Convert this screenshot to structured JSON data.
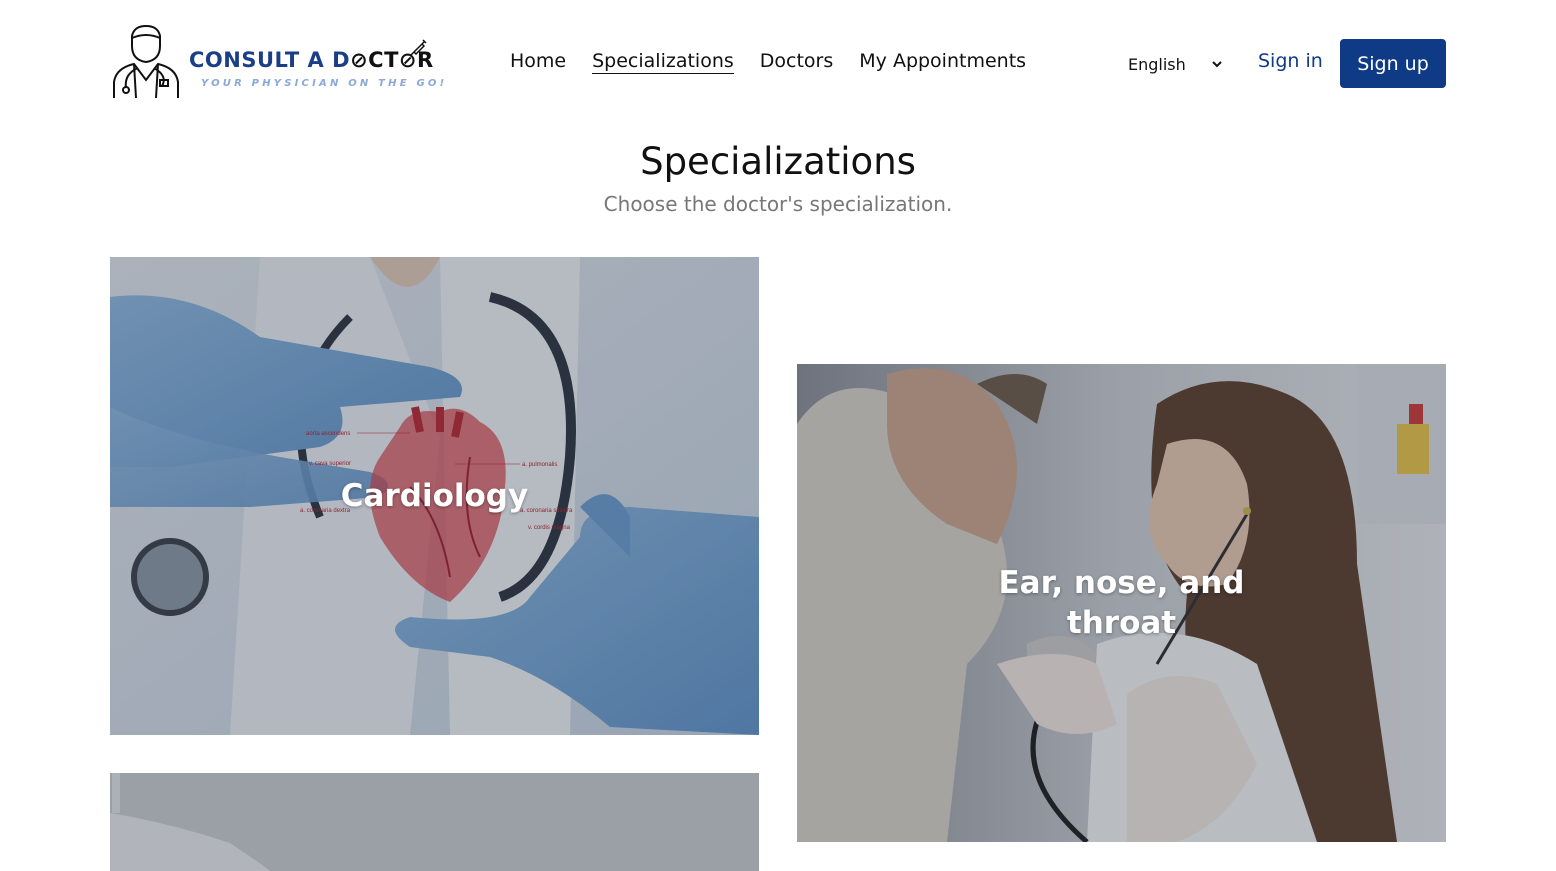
{
  "brand": {
    "name_part1": "CONSULT A D",
    "name_part2": "CT",
    "name_part3": "R",
    "tagline": "YOUR PHYSICIAN ON THE GO!"
  },
  "nav": {
    "items": [
      {
        "label": "Home",
        "active": false
      },
      {
        "label": "Specializations",
        "active": true
      },
      {
        "label": "Doctors",
        "active": false
      },
      {
        "label": "My Appointments",
        "active": false
      }
    ]
  },
  "language": {
    "selected": "English"
  },
  "auth": {
    "signin_label": "Sign in",
    "signup_label": "Sign up"
  },
  "page": {
    "title": "Specializations",
    "subtitle": "Choose the doctor's specialization."
  },
  "specializations": [
    {
      "name": "Cardiology"
    },
    {
      "name": "Ear, nose, and throat"
    }
  ],
  "colors": {
    "brand_blue": "#0f3a86",
    "tagline_blue": "#8aa8d8",
    "subtitle_gray": "#777777"
  },
  "heart_labels": [
    "aorta ascendens",
    "v. cava superior",
    "a. coronaria dextra",
    "a. pulmonalis",
    "a. coronaria sinistra",
    "v. cordis magna"
  ]
}
